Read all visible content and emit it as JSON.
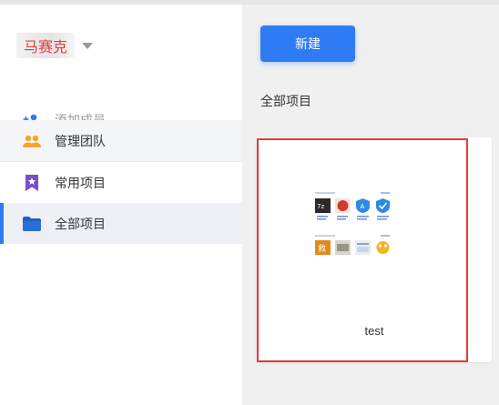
{
  "workspace": {
    "name": "马赛克"
  },
  "sidebar": {
    "items": [
      {
        "label": "添加成员",
        "icon": "add-person-icon"
      },
      {
        "label": "管理团队",
        "icon": "team-icon"
      },
      {
        "label": "常用项目",
        "icon": "bookmark-star-icon"
      },
      {
        "label": "全部项目",
        "icon": "folder-icon"
      }
    ]
  },
  "main": {
    "new_button": "新建",
    "section_title": "全部项目",
    "projects": [
      {
        "name": "test"
      }
    ]
  },
  "colors": {
    "accent": "#2f7bf6",
    "highlight_border": "#e53935",
    "workspace_text": "#e33d3d"
  }
}
